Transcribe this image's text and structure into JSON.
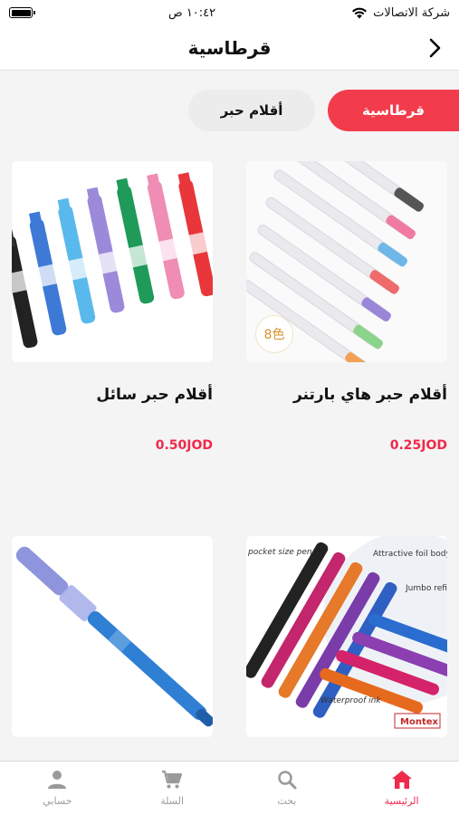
{
  "status_bar": {
    "carrier": "شركة الاتصالات",
    "time": "١٠:٤٢ ص"
  },
  "header": {
    "title": "قرطاسية"
  },
  "filters": [
    {
      "label": "قرطاسية",
      "active": true
    },
    {
      "label": "أقلام حبر",
      "active": false
    }
  ],
  "products": [
    {
      "name": "أقلام حبر هاي بارتنر",
      "price": "0.25JOD",
      "badge": "8色"
    },
    {
      "name": "أقلام حبر سائل",
      "price": "0.50JOD"
    },
    {
      "name": "",
      "price": "",
      "image_texts": [
        "pocket size pen",
        "Attractive foil body",
        "Jumbo refill",
        "Waterproof ink",
        "Montex"
      ]
    },
    {
      "name": "",
      "price": ""
    }
  ],
  "tabbar": [
    {
      "label": "الرئيسية",
      "icon": "home-icon",
      "active": true
    },
    {
      "label": "بحث",
      "icon": "search-icon",
      "active": false
    },
    {
      "label": "السلة",
      "icon": "cart-icon",
      "active": false
    },
    {
      "label": "حسابي",
      "icon": "person-icon",
      "active": false
    }
  ],
  "colors": {
    "accent": "#ef2a4b",
    "chip_active": "#f23c4c",
    "inactive": "#9a9a9a"
  }
}
